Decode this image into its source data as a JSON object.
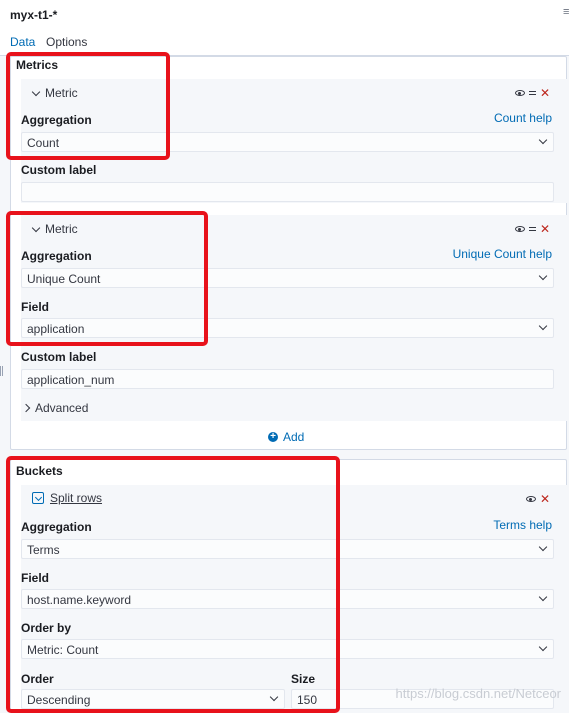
{
  "header": {
    "index_pattern": "myx-t1-*",
    "collapse_glyph": "≡"
  },
  "tabs": [
    {
      "label": "Data",
      "active": true
    },
    {
      "label": "Options",
      "active": false
    }
  ],
  "metrics": {
    "title": "Metrics",
    "items": [
      {
        "header": "Metric",
        "aggregation_label": "Aggregation",
        "help": "Count help",
        "aggregation_value": "Count",
        "custom_label_label": "Custom label",
        "custom_label_value": ""
      },
      {
        "header": "Metric",
        "aggregation_label": "Aggregation",
        "help": "Unique Count help",
        "aggregation_value": "Unique Count",
        "field_label": "Field",
        "field_value": "application",
        "custom_label_label": "Custom label",
        "custom_label_value": "application_num",
        "advanced_label": "Advanced"
      }
    ],
    "add_label": "Add"
  },
  "buckets": {
    "title": "Buckets",
    "split": {
      "header": "Split rows",
      "aggregation_label": "Aggregation",
      "help": "Terms help",
      "aggregation_value": "Terms",
      "field_label": "Field",
      "field_value": "host.name.keyword",
      "order_by_label": "Order by",
      "order_by_value": "Metric: Count",
      "order_label": "Order",
      "order_value": "Descending",
      "size_label": "Size",
      "size_value": "150"
    }
  },
  "icons": {
    "toggle": "eye-icon",
    "drag": "drag-handle-icon",
    "remove": "close-icon",
    "add": "plus-circle-icon"
  },
  "colors": {
    "link": "#006bb4",
    "danger": "#bd271e",
    "highlight": "#e8121b"
  },
  "watermark": "https://blog.csdn.net/Netceor"
}
